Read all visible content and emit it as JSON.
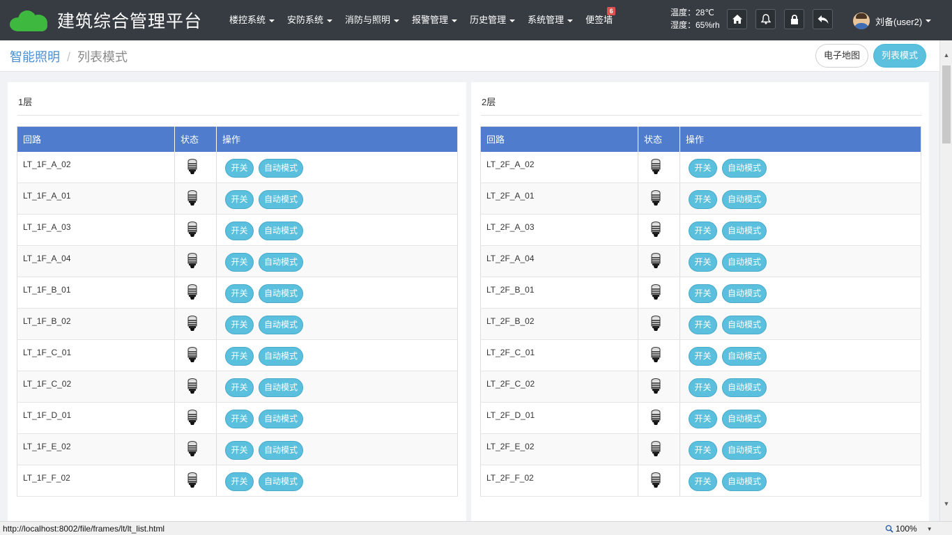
{
  "app": {
    "title": "建筑综合管理平台"
  },
  "colors": {
    "navbar": "#363c42",
    "brand_logo": "#3fb83f",
    "accent": "#5bc0de",
    "table_header": "#4f7ccc",
    "link": "#4a8ed3",
    "badge": "#d9534f"
  },
  "nav": {
    "menu": [
      {
        "label": "楼控系统",
        "dropdown": true
      },
      {
        "label": "安防系统",
        "dropdown": true
      },
      {
        "label": "消防与照明",
        "dropdown": true
      },
      {
        "label": "报警管理",
        "dropdown": true
      },
      {
        "label": "历史管理",
        "dropdown": true
      },
      {
        "label": "系统管理",
        "dropdown": true
      },
      {
        "label": "便签墙",
        "dropdown": false,
        "badge": "6"
      }
    ],
    "temperature": "温度：28℃",
    "humidity": "湿度：65%rh",
    "icons": [
      "home-icon",
      "bell-icon",
      "lock-icon",
      "reply-icon"
    ],
    "user": "刘备(user2)"
  },
  "breadcrumb": {
    "parent": "智能照明",
    "current": "列表模式"
  },
  "mode_buttons": {
    "map": "电子地图",
    "list": "列表模式"
  },
  "table_headers": {
    "circuit": "回路",
    "status": "状态",
    "action": "操作"
  },
  "action_labels": {
    "switch": "开关",
    "auto": "自动模式"
  },
  "floors": [
    {
      "name": "1层",
      "rows": [
        "LT_1F_A_02",
        "LT_1F_A_01",
        "LT_1F_A_03",
        "LT_1F_A_04",
        "LT_1F_B_01",
        "LT_1F_B_02",
        "LT_1F_C_01",
        "LT_1F_C_02",
        "LT_1F_D_01",
        "LT_1F_E_02",
        "LT_1F_F_02"
      ]
    },
    {
      "name": "2层",
      "rows": [
        "LT_2F_A_02",
        "LT_2F_A_01",
        "LT_2F_A_03",
        "LT_2F_A_04",
        "LT_2F_B_01",
        "LT_2F_B_02",
        "LT_2F_C_01",
        "LT_2F_C_02",
        "LT_2F_D_01",
        "LT_2F_E_02",
        "LT_2F_F_02"
      ]
    }
  ],
  "status_bar": {
    "url": "http://localhost:8002/file/frames/lt/lt_list.html",
    "zoom": "100%"
  }
}
